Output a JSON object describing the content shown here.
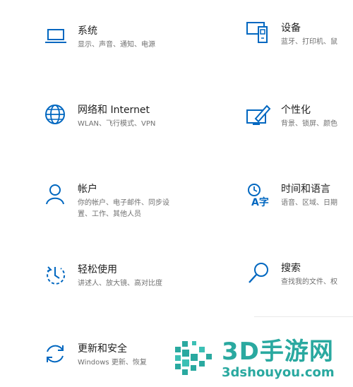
{
  "tiles": {
    "system": {
      "title": "系统",
      "desc": "显示、声音、通知、电源"
    },
    "network": {
      "title": "网络和 Internet",
      "desc": "WLAN、飞行模式、VPN"
    },
    "accounts": {
      "title": "帐户",
      "desc": "你的帐户、电子邮件、同步设",
      "desc2": "置、工作、其他人员"
    },
    "ease": {
      "title": "轻松使用",
      "desc": "讲述人、放大镜、高对比度"
    },
    "update": {
      "title": "更新和安全",
      "desc": "Windows 更新、恢复"
    },
    "devices": {
      "title": "设备",
      "desc": "蓝牙、打印机、鼠"
    },
    "personal": {
      "title": "个性化",
      "desc": "背景、锁屏、颜色"
    },
    "time": {
      "title": "时间和语言",
      "desc": "语音、区域、日期"
    },
    "search": {
      "title": "搜索",
      "desc": "查找我的文件、权"
    }
  },
  "watermark": {
    "big": "3D手游网",
    "small": "3dshouyou.com"
  },
  "colors": {
    "icon": "#0067c0",
    "watermark": "#2aa9a0"
  }
}
